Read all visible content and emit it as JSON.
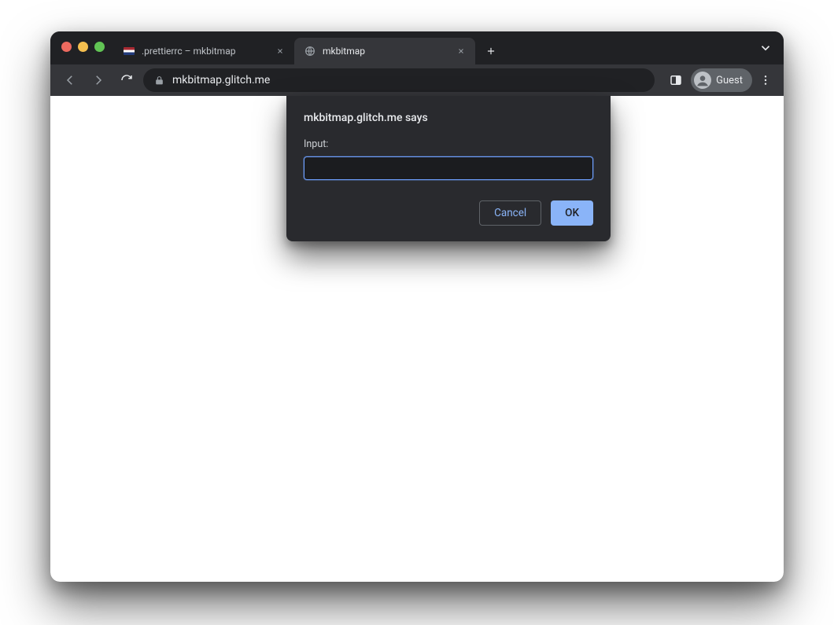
{
  "tabs": [
    {
      "title": ".prettierrc – mkbitmap",
      "active": false
    },
    {
      "title": "mkbitmap",
      "active": true
    }
  ],
  "toolbar": {
    "url": "mkbitmap.glitch.me",
    "profile_label": "Guest"
  },
  "dialog": {
    "title": "mkbitmap.glitch.me says",
    "label": "Input:",
    "input_value": "",
    "cancel_label": "Cancel",
    "ok_label": "OK"
  }
}
